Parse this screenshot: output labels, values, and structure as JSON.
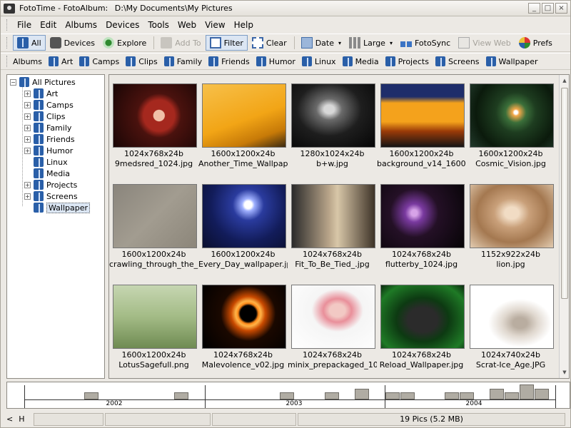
{
  "window": {
    "app_title": "FotoTime - FotoAlbum:",
    "path": "D:\\My Documents\\My Pictures",
    "controls": {
      "minimize": "_",
      "maximize": "□",
      "close": "×"
    }
  },
  "menu": [
    "File",
    "Edit",
    "Albums",
    "Devices",
    "Tools",
    "Web",
    "View",
    "Help"
  ],
  "toolbar": {
    "all": "All",
    "devices": "Devices",
    "explore": "Explore",
    "add_to": "Add To",
    "filter": "Filter",
    "clear": "Clear",
    "date": "Date",
    "large": "Large",
    "fotosync": "FotoSync",
    "view_web": "View Web",
    "prefs": "Prefs",
    "dropdown_caret": "▾"
  },
  "albumbar": {
    "label": "Albums",
    "items": [
      "Art",
      "Camps",
      "Clips",
      "Family",
      "Friends",
      "Humor",
      "Linux",
      "Media",
      "Projects",
      "Screens",
      "Wallpaper"
    ]
  },
  "tree": {
    "root": "All Pictures",
    "expand_glyph": "+",
    "collapse_glyph": "−",
    "items": [
      {
        "label": "Art",
        "expandable": true
      },
      {
        "label": "Camps",
        "expandable": true
      },
      {
        "label": "Clips",
        "expandable": true
      },
      {
        "label": "Family",
        "expandable": true
      },
      {
        "label": "Friends",
        "expandable": true
      },
      {
        "label": "Humor",
        "expandable": true
      },
      {
        "label": "Linux",
        "expandable": false
      },
      {
        "label": "Media",
        "expandable": false
      },
      {
        "label": "Projects",
        "expandable": true
      },
      {
        "label": "Screens",
        "expandable": true
      },
      {
        "label": "Wallpaper",
        "expandable": false,
        "selected": true
      }
    ]
  },
  "thumbnails": [
    {
      "dims": "1024x768x24b",
      "name": "9medsred_1024.jpg"
    },
    {
      "dims": "1600x1200x24b",
      "name": "Another_Time_Wallpap..."
    },
    {
      "dims": "1280x1024x24b",
      "name": "b+w.jpg"
    },
    {
      "dims": "1600x1200x24b",
      "name": "background_v14_1600..."
    },
    {
      "dims": "1600x1200x24b",
      "name": "Cosmic_Vision.jpg"
    },
    {
      "dims": "1600x1200x24b",
      "name": "crawling_through_the_..."
    },
    {
      "dims": "1600x1200x24b",
      "name": "Every_Day_wallpaper.jpg"
    },
    {
      "dims": "1024x768x24b",
      "name": "Fit_To_Be_Tied_.jpg"
    },
    {
      "dims": "1024x768x24b",
      "name": "flutterby_1024.jpg"
    },
    {
      "dims": "1152x922x24b",
      "name": "lion.jpg"
    },
    {
      "dims": "1600x1200x24b",
      "name": "LotusSagefull.png"
    },
    {
      "dims": "1024x768x24b",
      "name": "Malevolence_v02.jpg"
    },
    {
      "dims": "1024x768x24b",
      "name": "minix_prepackaged_10..."
    },
    {
      "dims": "1024x768x24b",
      "name": "Reload_Wallpaper.jpg"
    },
    {
      "dims": "1024x740x24b",
      "name": "Scrat-Ice_Age.JPG"
    }
  ],
  "scrollbar": {
    "up": "▲",
    "down": "▼"
  },
  "timeline": {
    "years": [
      "2002",
      "2003",
      "2004"
    ]
  },
  "status": {
    "nav_prev": "<",
    "nav_h": "H",
    "summary": "19 Pics (5.2 MB)"
  }
}
